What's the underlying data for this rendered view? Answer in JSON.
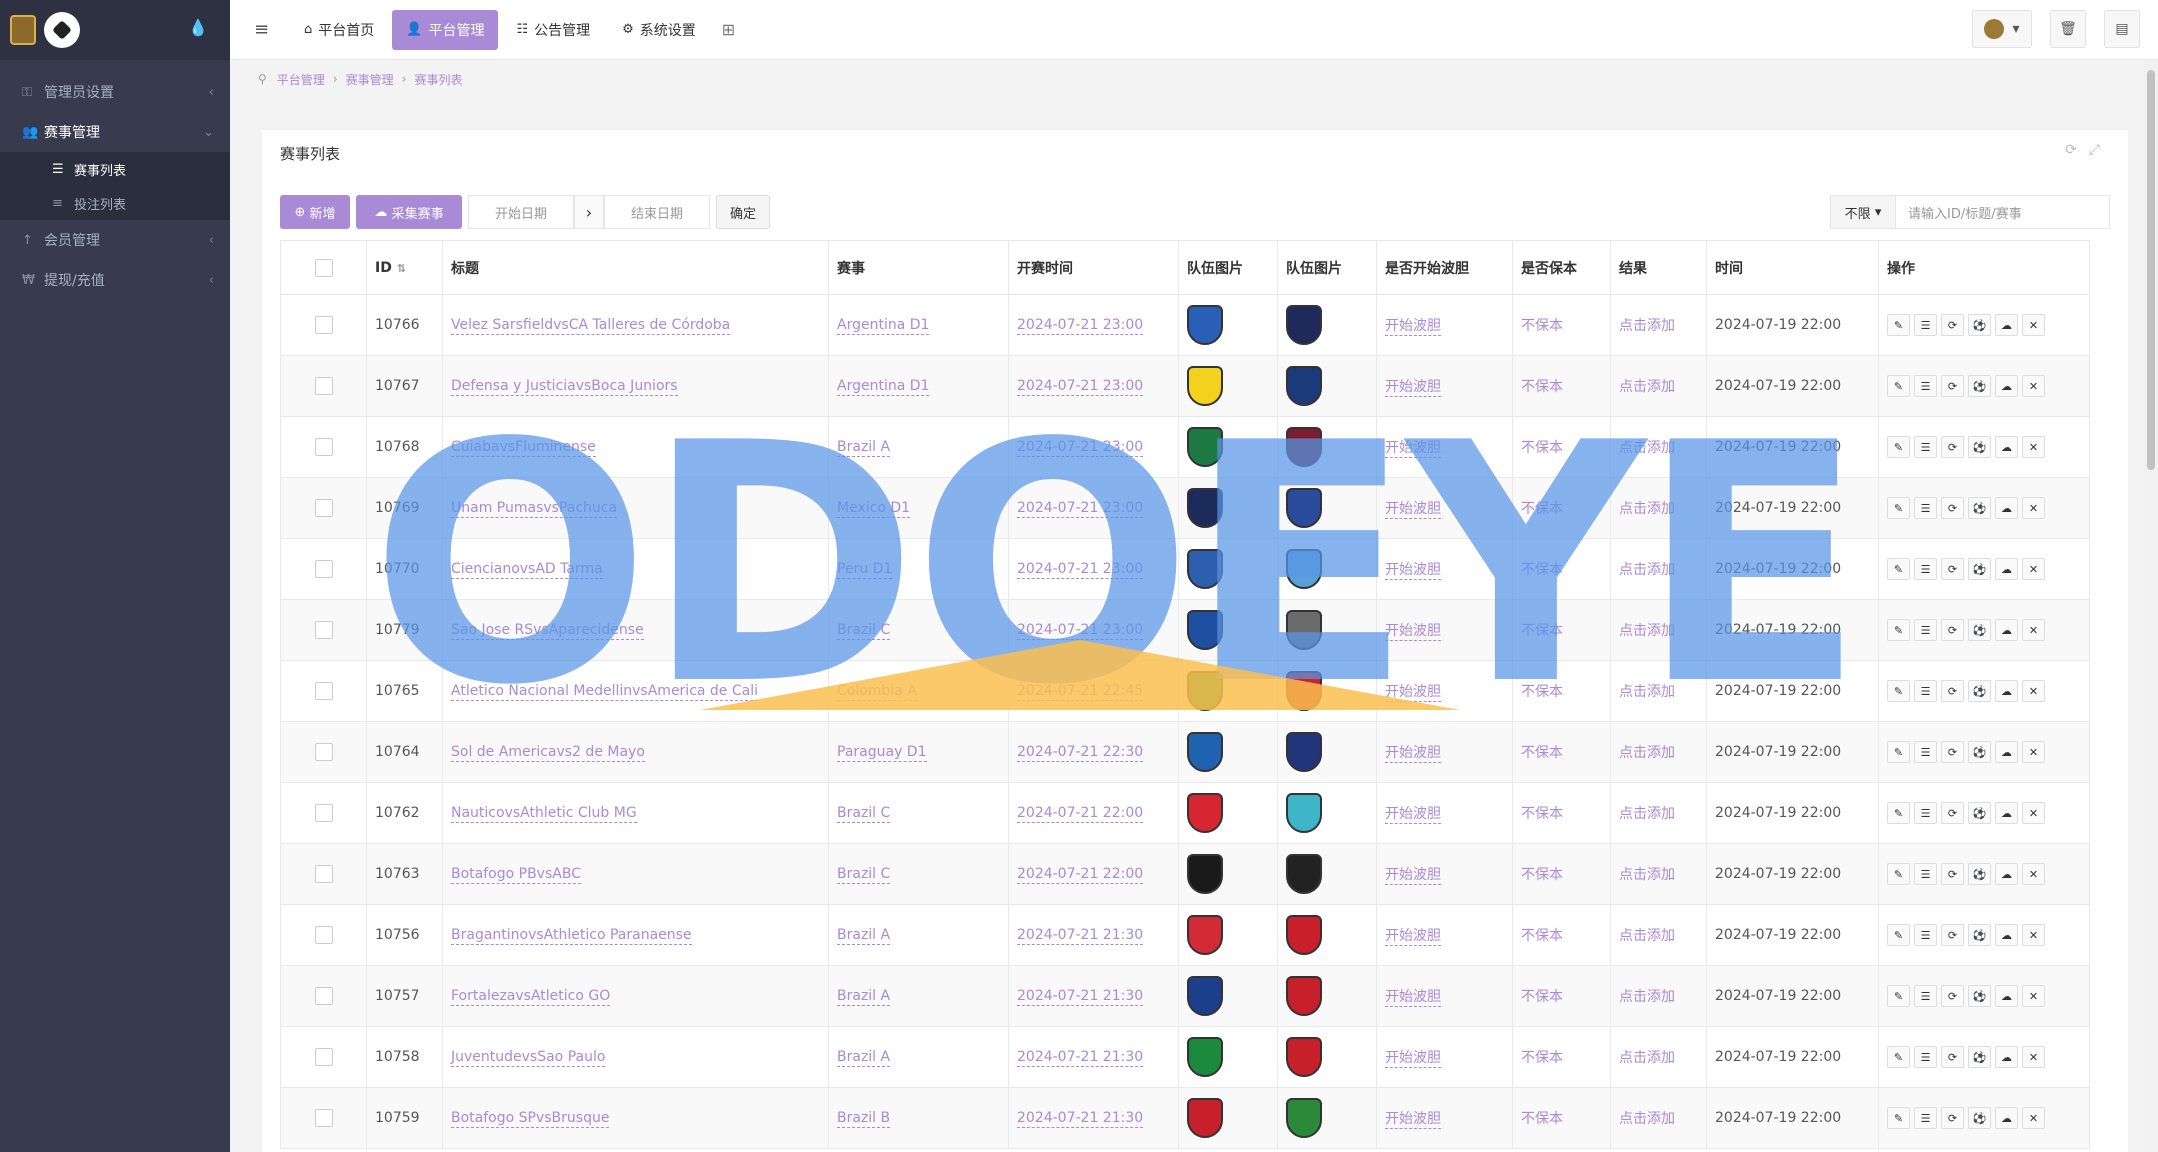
{
  "sidebar": {
    "items": [
      {
        "label": "管理员设置",
        "icon": "key-icon"
      },
      {
        "label": "赛事管理",
        "icon": "users-icon"
      },
      {
        "label": "赛事列表",
        "icon": "list-icon"
      },
      {
        "label": "投注列表",
        "icon": "bars-icon"
      },
      {
        "label": "会员管理",
        "icon": "arrow-up-icon"
      },
      {
        "label": "提现/充值",
        "icon": "won-icon"
      }
    ]
  },
  "topbar": {
    "tabs": [
      {
        "label": "平台首页",
        "icon": "home-icon"
      },
      {
        "label": "平台管理",
        "icon": "user-icon"
      },
      {
        "label": "公告管理",
        "icon": "list-icon"
      },
      {
        "label": "系统设置",
        "icon": "gear-icon"
      }
    ]
  },
  "breadcrumb": [
    "平台管理",
    "赛事管理",
    "赛事列表"
  ],
  "panel": {
    "title": "赛事列表",
    "add_label": "新增",
    "collect_label": "采集赛事",
    "start_placeholder": "开始日期",
    "end_placeholder": "结束日期",
    "confirm_label": "确定",
    "filter_value": "不限",
    "search_placeholder": "请输入ID/标题/赛事"
  },
  "table": {
    "headers": [
      "ID",
      "标题",
      "赛事",
      "开赛时间",
      "队伍图片",
      "队伍图片",
      "是否开始波胆",
      "是否保本",
      "结果",
      "时间",
      "操作"
    ],
    "rows": [
      {
        "id": "10766",
        "title": "Velez SarsfieldvsCA Talleres de Córdoba",
        "league": "Argentina D1",
        "start": "2024-07-21 23:00",
        "bodan": "开始波胆",
        "baoben": "不保本",
        "result": "点击添加",
        "time": "2024-07-19 22:00",
        "c1": "#2a5fb8",
        "c2": "#1f2a5c"
      },
      {
        "id": "10767",
        "title": "Defensa y JusticiavsBoca Juniors",
        "league": "Argentina D1",
        "start": "2024-07-21 23:00",
        "bodan": "开始波胆",
        "baoben": "不保本",
        "result": "点击添加",
        "time": "2024-07-19 22:00",
        "c1": "#f2d21c",
        "c2": "#1b3a7a"
      },
      {
        "id": "10768",
        "title": "CuiabavsFluminense",
        "league": "Brazil A",
        "start": "2024-07-21 23:00",
        "bodan": "开始波胆",
        "baoben": "不保本",
        "result": "点击添加",
        "time": "2024-07-19 22:00",
        "c1": "#1d7a43",
        "c2": "#7b1d2c"
      },
      {
        "id": "10769",
        "title": "Unam PumasvsPachuca",
        "league": "Mexico D1",
        "start": "2024-07-21 23:00",
        "bodan": "开始波胆",
        "baoben": "不保本",
        "result": "点击添加",
        "time": "2024-07-19 22:00",
        "c1": "#1b2b5c",
        "c2": "#2b4b9c"
      },
      {
        "id": "10770",
        "title": "CiencianovsAD Tarma",
        "league": "Peru D1",
        "start": "2024-07-21 23:00",
        "bodan": "开始波胆",
        "baoben": "不保本",
        "result": "点击添加",
        "time": "2024-07-19 22:00",
        "c1": "#2d5fb0",
        "c2": "#5aa0d8"
      },
      {
        "id": "10779",
        "title": "Sao Jose RSvsAparecidense",
        "league": "Brazil C",
        "start": "2024-07-21 23:00",
        "bodan": "开始波胆",
        "baoben": "不保本",
        "result": "点击添加",
        "time": "2024-07-19 22:00",
        "c1": "#1e4fa0",
        "c2": "#6b6b6b"
      },
      {
        "id": "10765",
        "title": "Atletico Nacional MedellinvsAmerica de Cali",
        "league": "Colombia A",
        "start": "2024-07-21 22:45",
        "bodan": "开始波胆",
        "baoben": "不保本",
        "result": "点击添加",
        "time": "2024-07-19 22:00",
        "c1": "#1f8a3b",
        "c2": "#c8262d"
      },
      {
        "id": "10764",
        "title": "Sol de Americavs2 de Mayo",
        "league": "Paraguay D1",
        "start": "2024-07-21 22:30",
        "bodan": "开始波胆",
        "baoben": "不保本",
        "result": "点击添加",
        "time": "2024-07-19 22:00",
        "c1": "#1f63b0",
        "c2": "#23357a"
      },
      {
        "id": "10762",
        "title": "NauticovsAthletic Club MG",
        "league": "Brazil C",
        "start": "2024-07-21 22:00",
        "bodan": "开始波胆",
        "baoben": "不保本",
        "result": "点击添加",
        "time": "2024-07-19 22:00",
        "c1": "#d82630",
        "c2": "#3fb6c8"
      },
      {
        "id": "10763",
        "title": "Botafogo PBvsABC",
        "league": "Brazil C",
        "start": "2024-07-21 22:00",
        "bodan": "开始波胆",
        "baoben": "不保本",
        "result": "点击添加",
        "time": "2024-07-19 22:00",
        "c1": "#1a1a1a",
        "c2": "#222222"
      },
      {
        "id": "10756",
        "title": "BragantinovsAthletico Paranaense",
        "league": "Brazil A",
        "start": "2024-07-21 21:30",
        "bodan": "开始波胆",
        "baoben": "不保本",
        "result": "点击添加",
        "time": "2024-07-19 22:00",
        "c1": "#d22b35",
        "c2": "#c81f2a"
      },
      {
        "id": "10757",
        "title": "FortalezavsAtletico GO",
        "league": "Brazil A",
        "start": "2024-07-21 21:30",
        "bodan": "开始波胆",
        "baoben": "不保本",
        "result": "点击添加",
        "time": "2024-07-19 22:00",
        "c1": "#1c3f8c",
        "c2": "#c8202a"
      },
      {
        "id": "10758",
        "title": "JuventudevsSao Paulo",
        "league": "Brazil A",
        "start": "2024-07-21 21:30",
        "bodan": "开始波胆",
        "baoben": "不保本",
        "result": "点击添加",
        "time": "2024-07-19 22:00",
        "c1": "#1b8a3c",
        "c2": "#c8202a"
      },
      {
        "id": "10759",
        "title": "Botafogo SPvsBrusque",
        "league": "Brazil B",
        "start": "2024-07-21 21:30",
        "bodan": "开始波胆",
        "baoben": "不保本",
        "result": "点击添加",
        "time": "2024-07-19 22:00",
        "c1": "#c8202a",
        "c2": "#2a8a3a"
      }
    ]
  },
  "watermark": "ODOEYE",
  "colors": {
    "accent": "#a98ad6",
    "sidebar": "#383b4e"
  }
}
